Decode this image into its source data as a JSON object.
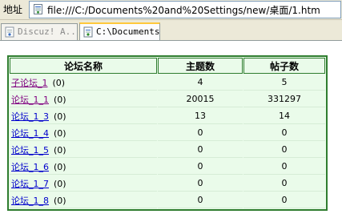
{
  "address_bar": {
    "label": "地址",
    "url": "file:///C:/Documents%20and%20Settings/new/桌面/1.htm"
  },
  "tabs": [
    {
      "label": "Discuz! A...",
      "active": false
    },
    {
      "label": "C:\\Documents...",
      "active": true
    }
  ],
  "table": {
    "headers": [
      "论坛名称",
      "主题数",
      "帖子数"
    ],
    "rows": [
      {
        "name": "子论坛_1",
        "count": "(0)",
        "topics": "4",
        "posts": "5",
        "visited": true
      },
      {
        "name": "论坛_1_1",
        "count": "(0)",
        "topics": "20015",
        "posts": "331297",
        "visited": true
      },
      {
        "name": "论坛_1_3",
        "count": "(0)",
        "topics": "13",
        "posts": "14",
        "visited": false
      },
      {
        "name": "论坛_1_4",
        "count": "(0)",
        "topics": "0",
        "posts": "0",
        "visited": false
      },
      {
        "name": "论坛_1_5",
        "count": "(0)",
        "topics": "0",
        "posts": "0",
        "visited": false
      },
      {
        "name": "论坛_1_6",
        "count": "(0)",
        "topics": "0",
        "posts": "0",
        "visited": false
      },
      {
        "name": "论坛_1_7",
        "count": "(0)",
        "topics": "0",
        "posts": "0",
        "visited": false
      },
      {
        "name": "论坛_1_8",
        "count": "(0)",
        "topics": "0",
        "posts": "0",
        "visited": false
      }
    ]
  },
  "colors": {
    "table_border": "#2f7d2f",
    "table_bg": "#eafbea",
    "link": "#0000cc",
    "visited_link": "#800080",
    "active_tab_accent": "#ffc83c"
  },
  "icons": {
    "address_page": "page-icon",
    "tab_1": "page-icon",
    "tab_2": "page-icon"
  }
}
